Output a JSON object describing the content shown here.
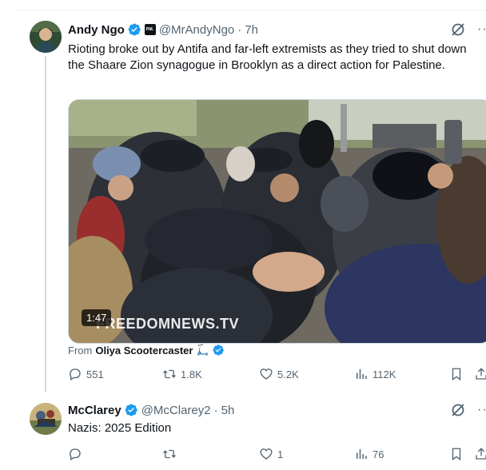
{
  "posts": [
    {
      "author": {
        "name": "Andy Ngo",
        "handle": "@MrAndyNgo",
        "time": "7h",
        "affiliate_badge": "P.M."
      },
      "text": "Rioting broke out by Antifa and far-left extremists as they tried to shut down the Shaare Zion synagogue in Brooklyn as a direct action for Palestine.",
      "media": {
        "duration": "1:47",
        "watermark": "FREEDOMNEWS.TV"
      },
      "from": {
        "prefix": "From",
        "name": "Oliya Scootercaster",
        "emoji": "🛴"
      },
      "stats": {
        "replies": "551",
        "reposts": "1.8K",
        "likes": "5.2K",
        "views": "112K"
      }
    },
    {
      "author": {
        "name": "McClarey",
        "handle": "@McClarey2",
        "time": "5h"
      },
      "text": "Nazis:  2025 Edition",
      "stats": {
        "replies": "",
        "reposts": "",
        "likes": "1",
        "views": "76"
      }
    }
  ],
  "ui": {
    "separator": "·",
    "more": "···"
  },
  "colors": {
    "verified": "#1d9bf0",
    "muted": "#536471",
    "text": "#0f1419",
    "thread_line": "#cfd9de"
  },
  "icons": [
    "verified-icon",
    "grok-icon",
    "more-icon",
    "reply-icon",
    "repost-icon",
    "like-icon",
    "views-icon",
    "bookmark-icon",
    "share-icon"
  ]
}
